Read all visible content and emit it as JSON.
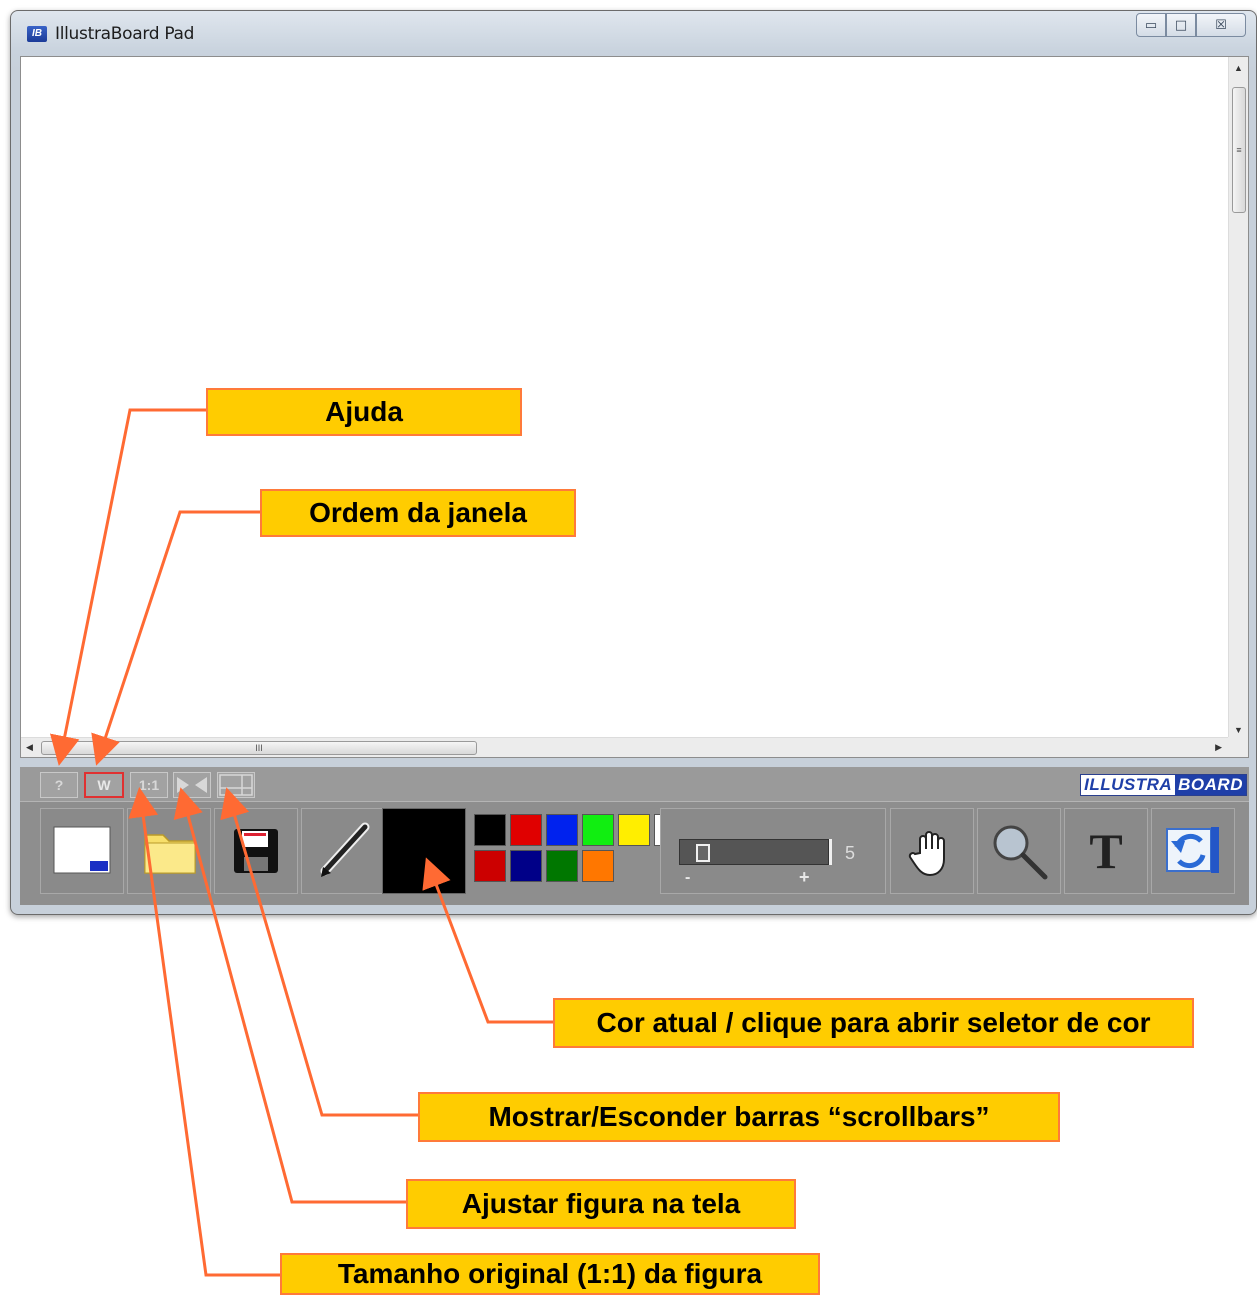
{
  "window": {
    "title": "IllustraBoard Pad",
    "app_icon": "IB",
    "caption": {
      "minimize": "▭",
      "maximize": "□",
      "close": "☒"
    }
  },
  "scrollbars": {
    "up": "▲",
    "down": "▼",
    "left": "◀",
    "right": "▶",
    "v_grip": "≡",
    "h_grip": "III"
  },
  "small_toolbar": {
    "help_label": "?",
    "window_order_label": "W",
    "original_size_label": "1:1",
    "fit_icon": "fit-to-screen-icon",
    "scrollbars_icon": "scrollbars-toggle-icon"
  },
  "logo": {
    "part1": "ILLUSTRA",
    "part2": "BOARD"
  },
  "toolbar": {
    "tools": [
      "new-canvas-icon",
      "open-folder-icon",
      "save-disk-icon",
      "pen-icon",
      "hand-icon",
      "magnifier-icon",
      "text-icon",
      "exit-icon"
    ],
    "text_tool_label": "T",
    "current_color": "#000000",
    "palette": [
      "#000000",
      "#e00000",
      "#0022ee",
      "#11ee11",
      "#ffee00",
      "#ffffff",
      "#cc0000",
      "#000088",
      "#007700",
      "#ff7700"
    ],
    "pen_size": "5",
    "pen_size_minus": "-",
    "pen_size_plus": "+",
    "pen_size_fraction": 0.12
  },
  "callouts": {
    "help": "Ajuda",
    "window_order": "Ordem da janela",
    "current_color": "Cor atual / clique para abrir seletor de cor",
    "scrollbars": "Mostrar/Esconder barras “scrollbars”",
    "fit": "Ajustar figura na tela",
    "original_size": "Tamanho original (1:1) da figura"
  },
  "colors": {
    "callout_fill": "#ffcc00",
    "callout_border": "#ff7a3a",
    "arrow": "#ff6a33"
  }
}
